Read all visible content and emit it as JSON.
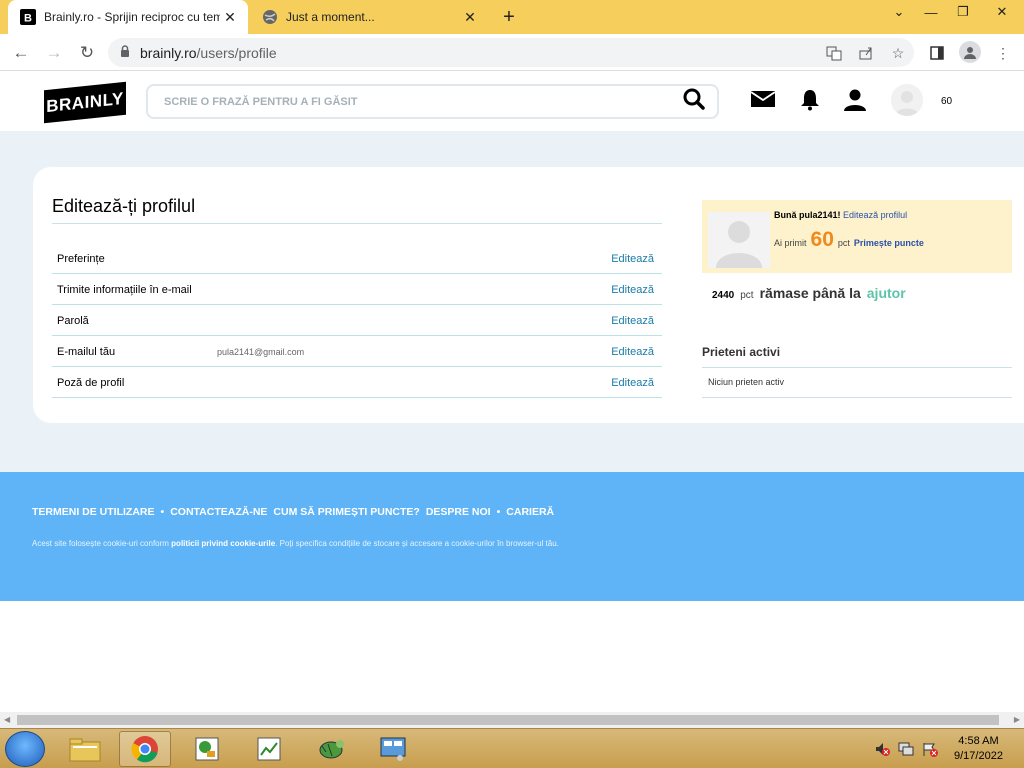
{
  "browser": {
    "tabs": [
      {
        "title": "Brainly.ro - Sprijin reciproc cu teme",
        "active": true
      },
      {
        "title": "Just a moment...",
        "active": false
      }
    ],
    "url_host": "brainly.ro",
    "url_path": "/users/profile"
  },
  "header": {
    "logo": "BRAINLY",
    "search_placeholder": "SCRIE O FRAZĂ PENTRU A FI GĂSIT",
    "points": "60"
  },
  "profile": {
    "title": "Editează-ți profilul",
    "rows": [
      {
        "label": "Preferințe",
        "value": "",
        "action": "Editează"
      },
      {
        "label": "Trimite informațiile în e-mail",
        "value": "",
        "action": "Editează"
      },
      {
        "label": "Parolă",
        "value": "",
        "action": "Editează"
      },
      {
        "label": "E-mailul tău",
        "value": "pula2141@gmail.com",
        "action": "Editează"
      },
      {
        "label": "Poză de profil",
        "value": "",
        "action": "Editează"
      }
    ]
  },
  "sidebar": {
    "greeting": "Bună pula2141!",
    "edit_profile": "Editează profilul",
    "received_label": "Ai primit",
    "points": "60",
    "points_unit": "pct",
    "get_points": "Primește puncte",
    "remaining_points": "2440",
    "remaining_unit": "pct",
    "remaining_text": "rămase până la",
    "remaining_target": "ajutor",
    "friends_title": "Prieteni activi",
    "friends_empty": "Niciun prieten activ"
  },
  "footer": {
    "links": [
      "TERMENI DE UTILIZARE",
      "CONTACTEAZĂ-NE",
      "CUM SĂ PRIMEȘTI PUNCTE?",
      "DESPRE NOI",
      "CARIERĂ"
    ],
    "separator": "•",
    "note_before": "Acest site folosește cookie-uri conform ",
    "note_link": "politicii privind cookie-urile",
    "note_after": ". Poți specifica condițiile de stocare și accesare a cookie-urilor în browser-ul tău."
  },
  "taskbar": {
    "time": "4:58 AM",
    "date": "9/17/2022"
  },
  "colors": {
    "tabbar": "#f5ce5c",
    "footer": "#5fb4f7",
    "accent_link": "#1a7ca7",
    "points_orange": "#f08a1c",
    "green": "#5ec3a8"
  }
}
